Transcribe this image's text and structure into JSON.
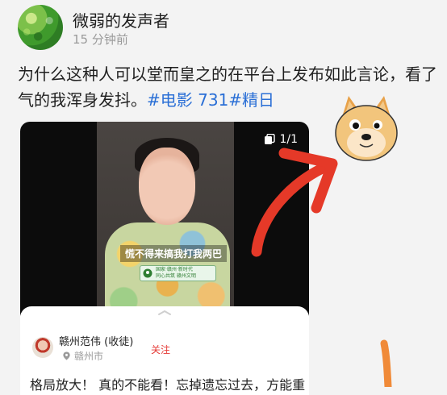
{
  "post": {
    "user_name": "微弱的发声者",
    "time": "15 分钟前",
    "text": "为什么这种人可以堂而皇之的在平台上发布如此言论，看了气的我浑身发抖。",
    "hashtag": "#电影 731#精日"
  },
  "video": {
    "page_counter": "1/1",
    "subtitle": "慌不得来搞我打我两巴",
    "badge_line1": "国家·赣州·新时代",
    "badge_line2": "同心共筑 赣州文明"
  },
  "comment": {
    "name": "赣州范伟 (收徒)",
    "follow_label": "关注",
    "location": "赣州市",
    "text": "格局放大！ 真的不能看！忘掉遗忘过去，方能重"
  },
  "colors": {
    "hashtag": "#2a6fd6",
    "annotation_arrow": "#e53928",
    "follow": "#e53935"
  },
  "icons": [
    "copy-icon",
    "location-pin-icon",
    "drag-handle-icon",
    "doge-emoji"
  ]
}
